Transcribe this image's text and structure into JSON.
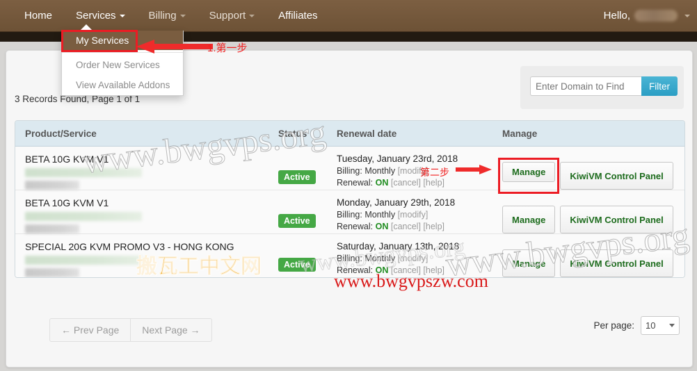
{
  "nav": {
    "items": [
      {
        "label": "Home",
        "has_caret": false,
        "dim": false
      },
      {
        "label": "Services",
        "has_caret": true,
        "dim": false
      },
      {
        "label": "Billing",
        "has_caret": true,
        "dim": true
      },
      {
        "label": "Support",
        "has_caret": true,
        "dim": true
      },
      {
        "label": "Affiliates",
        "has_caret": false,
        "dim": false
      }
    ],
    "greeting": "Hello,",
    "username_redacted": ""
  },
  "dropdown": {
    "selected": "My Services",
    "items": [
      {
        "label": "Order New Services"
      },
      {
        "label": "View Available Addons"
      }
    ]
  },
  "filter": {
    "placeholder": "Enter Domain to Find",
    "value": "",
    "button_label": "Filter"
  },
  "records_line": "3 Records Found, Page 1 of 1",
  "table": {
    "headers": {
      "product": "Product/Service",
      "status": "Status",
      "renewal": "Renewal date",
      "manage": "Manage"
    },
    "rows": [
      {
        "product": "BETA 10G KVM V1",
        "status": "Active",
        "date": "Tuesday, January 23rd, 2018",
        "billing_label": "Billing:",
        "billing_value": "Monthly",
        "billing_modify": "[modify]",
        "renewal_label": "Renewal:",
        "renewal_value": "ON",
        "renewal_cancel": "[cancel]",
        "renewal_help": "[help]",
        "manage_label": "Manage",
        "panel_label": "KiwiVM Control Panel",
        "highlight_manage": true
      },
      {
        "product": "BETA 10G KVM V1",
        "status": "Active",
        "date": "Monday, January 29th, 2018",
        "billing_label": "Billing:",
        "billing_value": "Monthly",
        "billing_modify": "[modify]",
        "renewal_label": "Renewal:",
        "renewal_value": "ON",
        "renewal_cancel": "[cancel]",
        "renewal_help": "[help]",
        "manage_label": "Manage",
        "panel_label": "KiwiVM Control Panel",
        "highlight_manage": false
      },
      {
        "product": "SPECIAL 20G KVM PROMO V3 - HONG KONG",
        "status": "Active",
        "date": "Saturday, January 13th, 2018",
        "billing_label": "Billing:",
        "billing_value": "Monthly",
        "billing_modify": "[modify]",
        "renewal_label": "Renewal:",
        "renewal_value": "ON",
        "renewal_cancel": "[cancel]",
        "renewal_help": "[help]",
        "manage_label": "Manage",
        "panel_label": "KiwiVM Control Panel",
        "highlight_manage": false
      }
    ]
  },
  "footer": {
    "prev_label": "← Prev Page",
    "next_label": "Next Page →",
    "per_page_label": "Per page:",
    "per_page_value": "10"
  },
  "annotations": {
    "step1": "1.第一步",
    "step2": "第二步"
  },
  "watermarks": {
    "site_org_a": "www.bwgvps.org",
    "site_org_b": "www.bwgvps.org",
    "site_zw": "www.bwgvpszw.com",
    "cn_text": "搬瓦工中文网",
    "faint": "www.bwgvps.org"
  },
  "colors": {
    "nav_brown": "#7c5f42",
    "accent_red": "#ec1c24",
    "filter_blue": "#2b9ec4",
    "badge_green": "#45a845",
    "button_green_text": "#1c6b1c"
  }
}
